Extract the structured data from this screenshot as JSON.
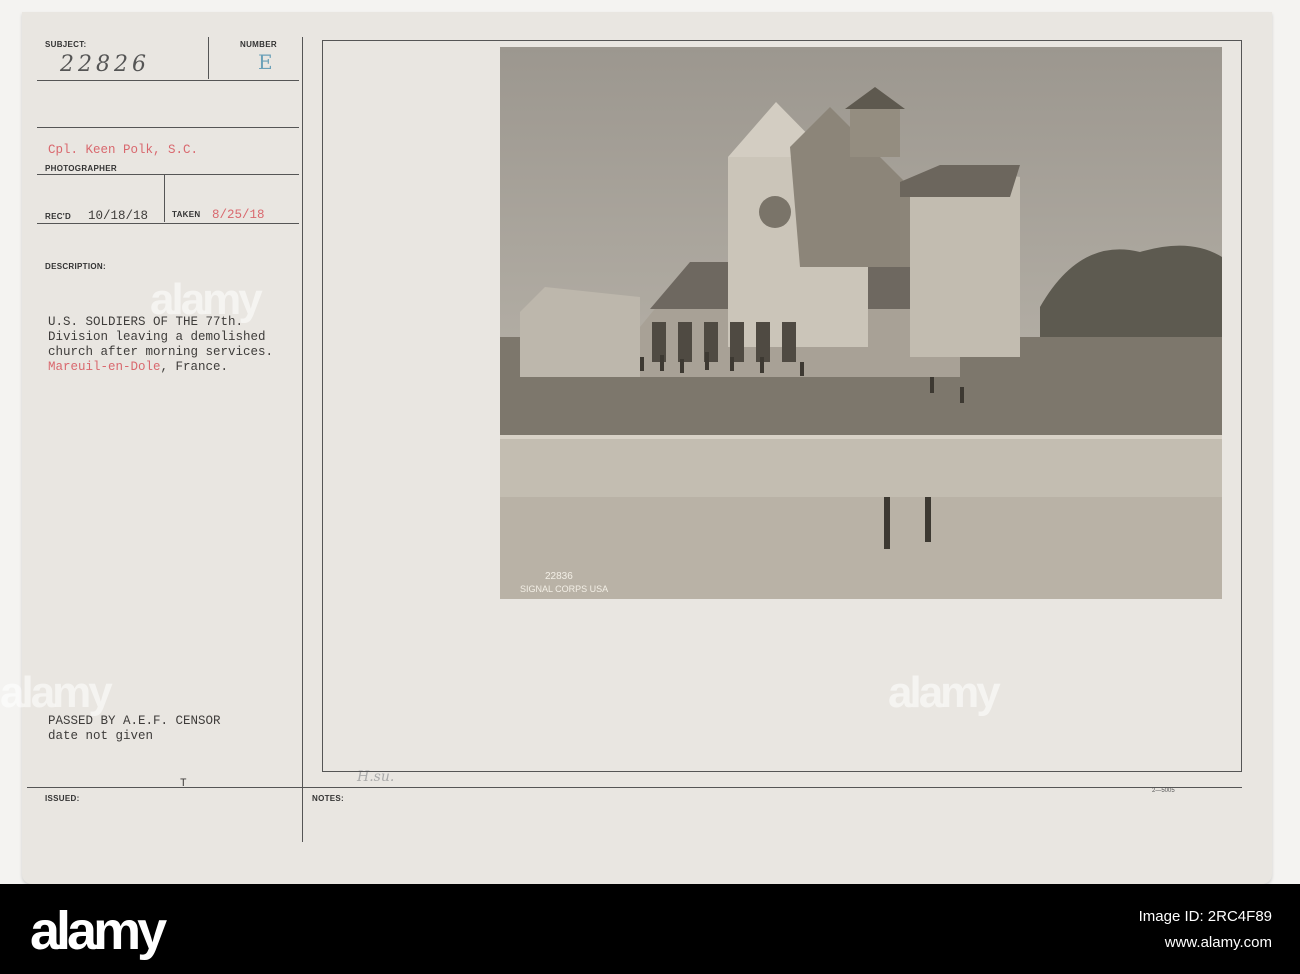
{
  "card": {
    "subject_label": "SUBJECT:",
    "subject_value": "22826",
    "number_label": "NUMBER",
    "number_value": "E",
    "photographer_value": "Cpl. Keen Polk, S.C.",
    "photographer_label": "PHOTOGRAPHER",
    "recd_label": "REC'D",
    "recd_value": "10/18/18",
    "taken_label": "TAKEN",
    "taken_value": "8/25/18",
    "description_label": "DESCRIPTION:",
    "description_lines": [
      "U.S. SOLDIERS OF THE 77th.",
      "Division leaving a demolished",
      "church after morning services."
    ],
    "location": "Mareuil-en-Dole",
    "location_suffix": ", France.",
    "censor_line1": "PASSED BY A.E.F. CENSOR",
    "censor_line2": "date not given",
    "issued_label": "ISSUED:",
    "issued_mark": "T",
    "notes_label": "NOTES:",
    "notes_handwriting": "H.su.",
    "form_number": "2—5005",
    "photo_stamp": "SIGNAL CORPS USA",
    "photo_number": "22836"
  },
  "watermark": "alamy",
  "footer": {
    "logo": "alamy",
    "image_id": "Image ID: 2RC4F89",
    "url": "www.alamy.com"
  },
  "colors": {
    "card": "#e9e6e1",
    "red_type": "#d9686e",
    "number_stamp": "#6aa0b8"
  }
}
